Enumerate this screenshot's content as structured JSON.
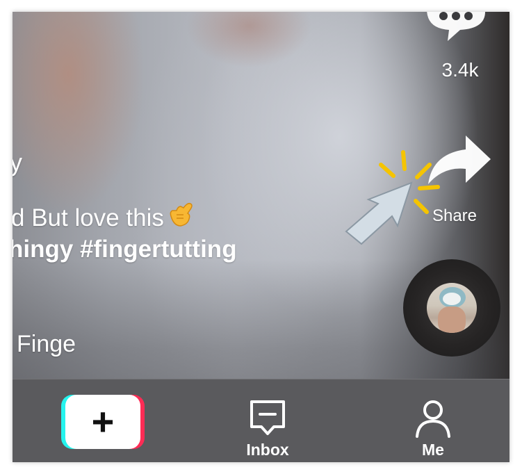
{
  "video": {
    "title_fragment": "y",
    "caption_line1": "d But love this",
    "caption_emoji": "🤙",
    "caption_line2": "hingy #fingertutting",
    "music_text": "Finge"
  },
  "actions": {
    "comment": {
      "icon": "comment-bubble-icon",
      "count": "3.4k"
    },
    "share": {
      "icon": "share-arrow-icon",
      "label": "Share"
    },
    "music_disc": {
      "icon": "music-disc-avatar"
    }
  },
  "overlay": {
    "cursor_icon": "click-cursor-icon",
    "sparkle_color": "#f5c400"
  },
  "bottom_nav": {
    "create": {
      "icon": "plus-icon",
      "label": "+",
      "colors": {
        "cyan": "#25f4ee",
        "pink": "#fe2c55"
      }
    },
    "inbox": {
      "icon": "inbox-icon",
      "label": "Inbox"
    },
    "me": {
      "icon": "profile-icon",
      "label": "Me"
    }
  }
}
